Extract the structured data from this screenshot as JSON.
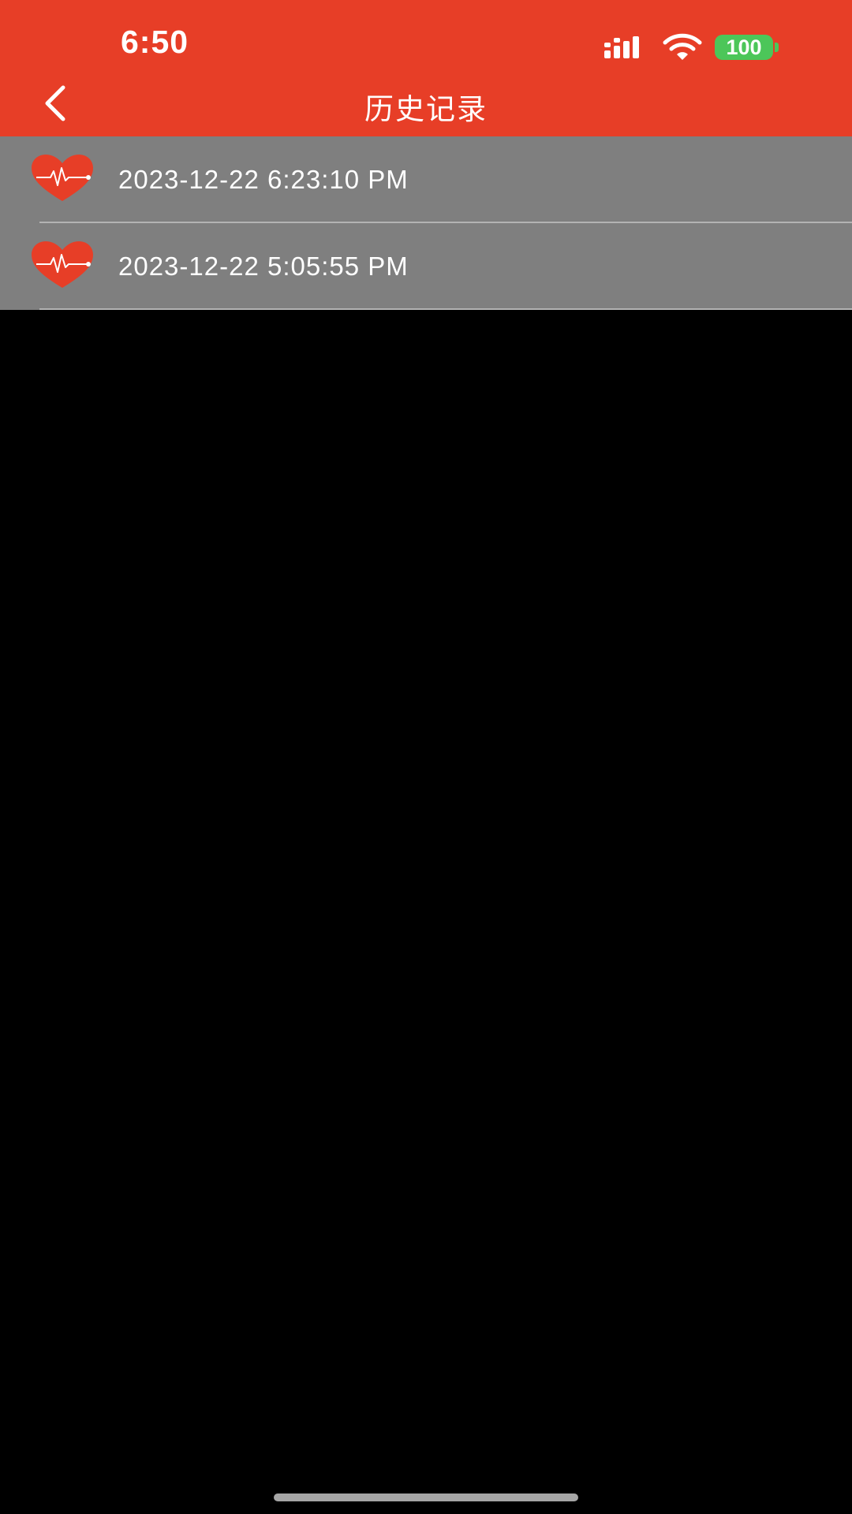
{
  "status_bar": {
    "time": "6:50",
    "battery": "100"
  },
  "nav": {
    "title": "历史记录",
    "back_icon": "chevron-left-icon"
  },
  "history": {
    "items": [
      {
        "label": "2023-12-22 6:23:10 PM",
        "icon": "heart-pulse-icon"
      },
      {
        "label": "2023-12-22 5:05:55 PM",
        "icon": "heart-pulse-icon"
      }
    ]
  },
  "colors": {
    "header": "#E73E27",
    "list_bg": "#7F7F7F",
    "heart": "#E73E27",
    "battery": "#4CC659",
    "background": "#000000"
  }
}
